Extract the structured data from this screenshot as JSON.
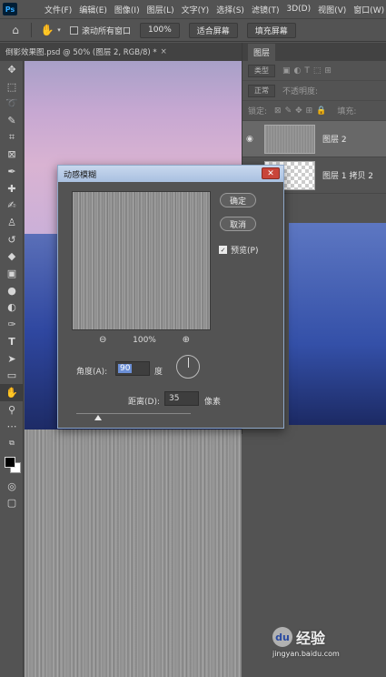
{
  "menubar": {
    "logo": "Ps",
    "items": [
      "文件(F)",
      "编辑(E)",
      "图像(I)",
      "图层(L)",
      "文字(Y)",
      "选择(S)",
      "滤镜(T)",
      "3D(D)",
      "视图(V)",
      "窗口(W)"
    ]
  },
  "optionsbar": {
    "scroll_all_label": "滚动所有窗口",
    "zoom_value": "100%",
    "fit_screen": "适合屏幕",
    "fill_screen": "填充屏幕"
  },
  "document": {
    "tab_title": "倒影效果图.psd @ 50% (图层 2, RGB/8) *",
    "close": "×"
  },
  "layers_panel": {
    "tab": "图层",
    "filter_label": "类型",
    "blend_mode": "正常",
    "opacity_label": "不透明度:",
    "lock_label": "锁定:",
    "fill_label": "填充:",
    "layers": [
      {
        "name": "图层 2",
        "selected": true
      },
      {
        "name": "图层 1 拷贝 2",
        "selected": false
      }
    ]
  },
  "dialog": {
    "title": "动感模糊",
    "ok": "确定",
    "cancel": "取消",
    "preview_label": "预览(P)",
    "preview_checked": true,
    "zoom_out": "⊖",
    "zoom_in": "⊕",
    "zoom_pct": "100%",
    "angle_label": "角度(A):",
    "angle_value": "90",
    "angle_unit": "度",
    "distance_label": "距离(D):",
    "distance_value": "35",
    "distance_unit": "像素"
  },
  "watermark": {
    "title": "经验",
    "url": "jingyan.baidu.com"
  }
}
